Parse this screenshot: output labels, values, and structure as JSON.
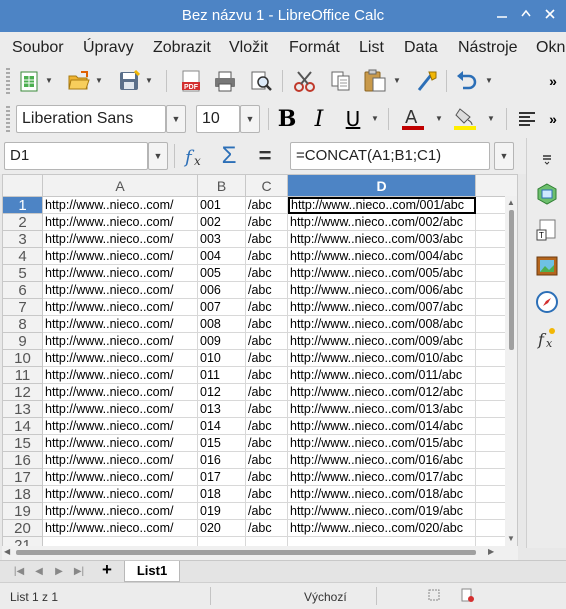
{
  "window": {
    "title": "Bez názvu 1 - LibreOffice Calc"
  },
  "menu": [
    "Soubor",
    "Úpravy",
    "Zobrazit",
    "Vložit",
    "Formát",
    "List",
    "Data",
    "Nástroje",
    "Okn"
  ],
  "toolbar": {
    "overflow": "»",
    "font_name": "Liberation Sans",
    "font_size": "10"
  },
  "formula_bar": {
    "name_box": "D1",
    "formula": "=CONCAT(A1;B1;C1)",
    "fx_symbol": "fx",
    "sum_symbol": "Σ",
    "equals_symbol": "="
  },
  "grid": {
    "columns": [
      "A",
      "B",
      "C",
      "D"
    ],
    "active_column": "D",
    "active_row": 1,
    "rows": [
      {
        "n": "1",
        "a": "http://www..nieco..com/",
        "b": "001",
        "c": "/abc",
        "d": "http://www..nieco..com/001/abc"
      },
      {
        "n": "2",
        "a": "http://www..nieco..com/",
        "b": "002",
        "c": "/abc",
        "d": "http://www..nieco..com/002/abc"
      },
      {
        "n": "3",
        "a": "http://www..nieco..com/",
        "b": "003",
        "c": "/abc",
        "d": "http://www..nieco..com/003/abc"
      },
      {
        "n": "4",
        "a": "http://www..nieco..com/",
        "b": "004",
        "c": "/abc",
        "d": "http://www..nieco..com/004/abc"
      },
      {
        "n": "5",
        "a": "http://www..nieco..com/",
        "b": "005",
        "c": "/abc",
        "d": "http://www..nieco..com/005/abc"
      },
      {
        "n": "6",
        "a": "http://www..nieco..com/",
        "b": "006",
        "c": "/abc",
        "d": "http://www..nieco..com/006/abc"
      },
      {
        "n": "7",
        "a": "http://www..nieco..com/",
        "b": "007",
        "c": "/abc",
        "d": "http://www..nieco..com/007/abc"
      },
      {
        "n": "8",
        "a": "http://www..nieco..com/",
        "b": "008",
        "c": "/abc",
        "d": "http://www..nieco..com/008/abc"
      },
      {
        "n": "9",
        "a": "http://www..nieco..com/",
        "b": "009",
        "c": "/abc",
        "d": "http://www..nieco..com/009/abc"
      },
      {
        "n": "10",
        "a": "http://www..nieco..com/",
        "b": "010",
        "c": "/abc",
        "d": "http://www..nieco..com/010/abc"
      },
      {
        "n": "11",
        "a": "http://www..nieco..com/",
        "b": "011",
        "c": "/abc",
        "d": "http://www..nieco..com/011/abc"
      },
      {
        "n": "12",
        "a": "http://www..nieco..com/",
        "b": "012",
        "c": "/abc",
        "d": "http://www..nieco..com/012/abc"
      },
      {
        "n": "13",
        "a": "http://www..nieco..com/",
        "b": "013",
        "c": "/abc",
        "d": "http://www..nieco..com/013/abc"
      },
      {
        "n": "14",
        "a": "http://www..nieco..com/",
        "b": "014",
        "c": "/abc",
        "d": "http://www..nieco..com/014/abc"
      },
      {
        "n": "15",
        "a": "http://www..nieco..com/",
        "b": "015",
        "c": "/abc",
        "d": "http://www..nieco..com/015/abc"
      },
      {
        "n": "16",
        "a": "http://www..nieco..com/",
        "b": "016",
        "c": "/abc",
        "d": "http://www..nieco..com/016/abc"
      },
      {
        "n": "17",
        "a": "http://www..nieco..com/",
        "b": "017",
        "c": "/abc",
        "d": "http://www..nieco..com/017/abc"
      },
      {
        "n": "18",
        "a": "http://www..nieco..com/",
        "b": "018",
        "c": "/abc",
        "d": "http://www..nieco..com/018/abc"
      },
      {
        "n": "19",
        "a": "http://www..nieco..com/",
        "b": "019",
        "c": "/abc",
        "d": "http://www..nieco..com/019/abc"
      },
      {
        "n": "20",
        "a": "http://www..nieco..com/",
        "b": "020",
        "c": "/abc",
        "d": "http://www..nieco..com/020/abc"
      },
      {
        "n": "21",
        "a": "",
        "b": "",
        "c": "",
        "d": ""
      }
    ]
  },
  "sheet_tabs": {
    "add": "+",
    "tabs": [
      "List1"
    ]
  },
  "status": {
    "sheet_info": "List 1 z 1",
    "page_style": "Výchozí"
  },
  "colors": {
    "title_bar": "#4d84c5",
    "active_header": "#4d84c5",
    "pdf_red": "#d32f2f",
    "font_color_red": "#c00000",
    "highlight_yellow": "#ffee00"
  }
}
